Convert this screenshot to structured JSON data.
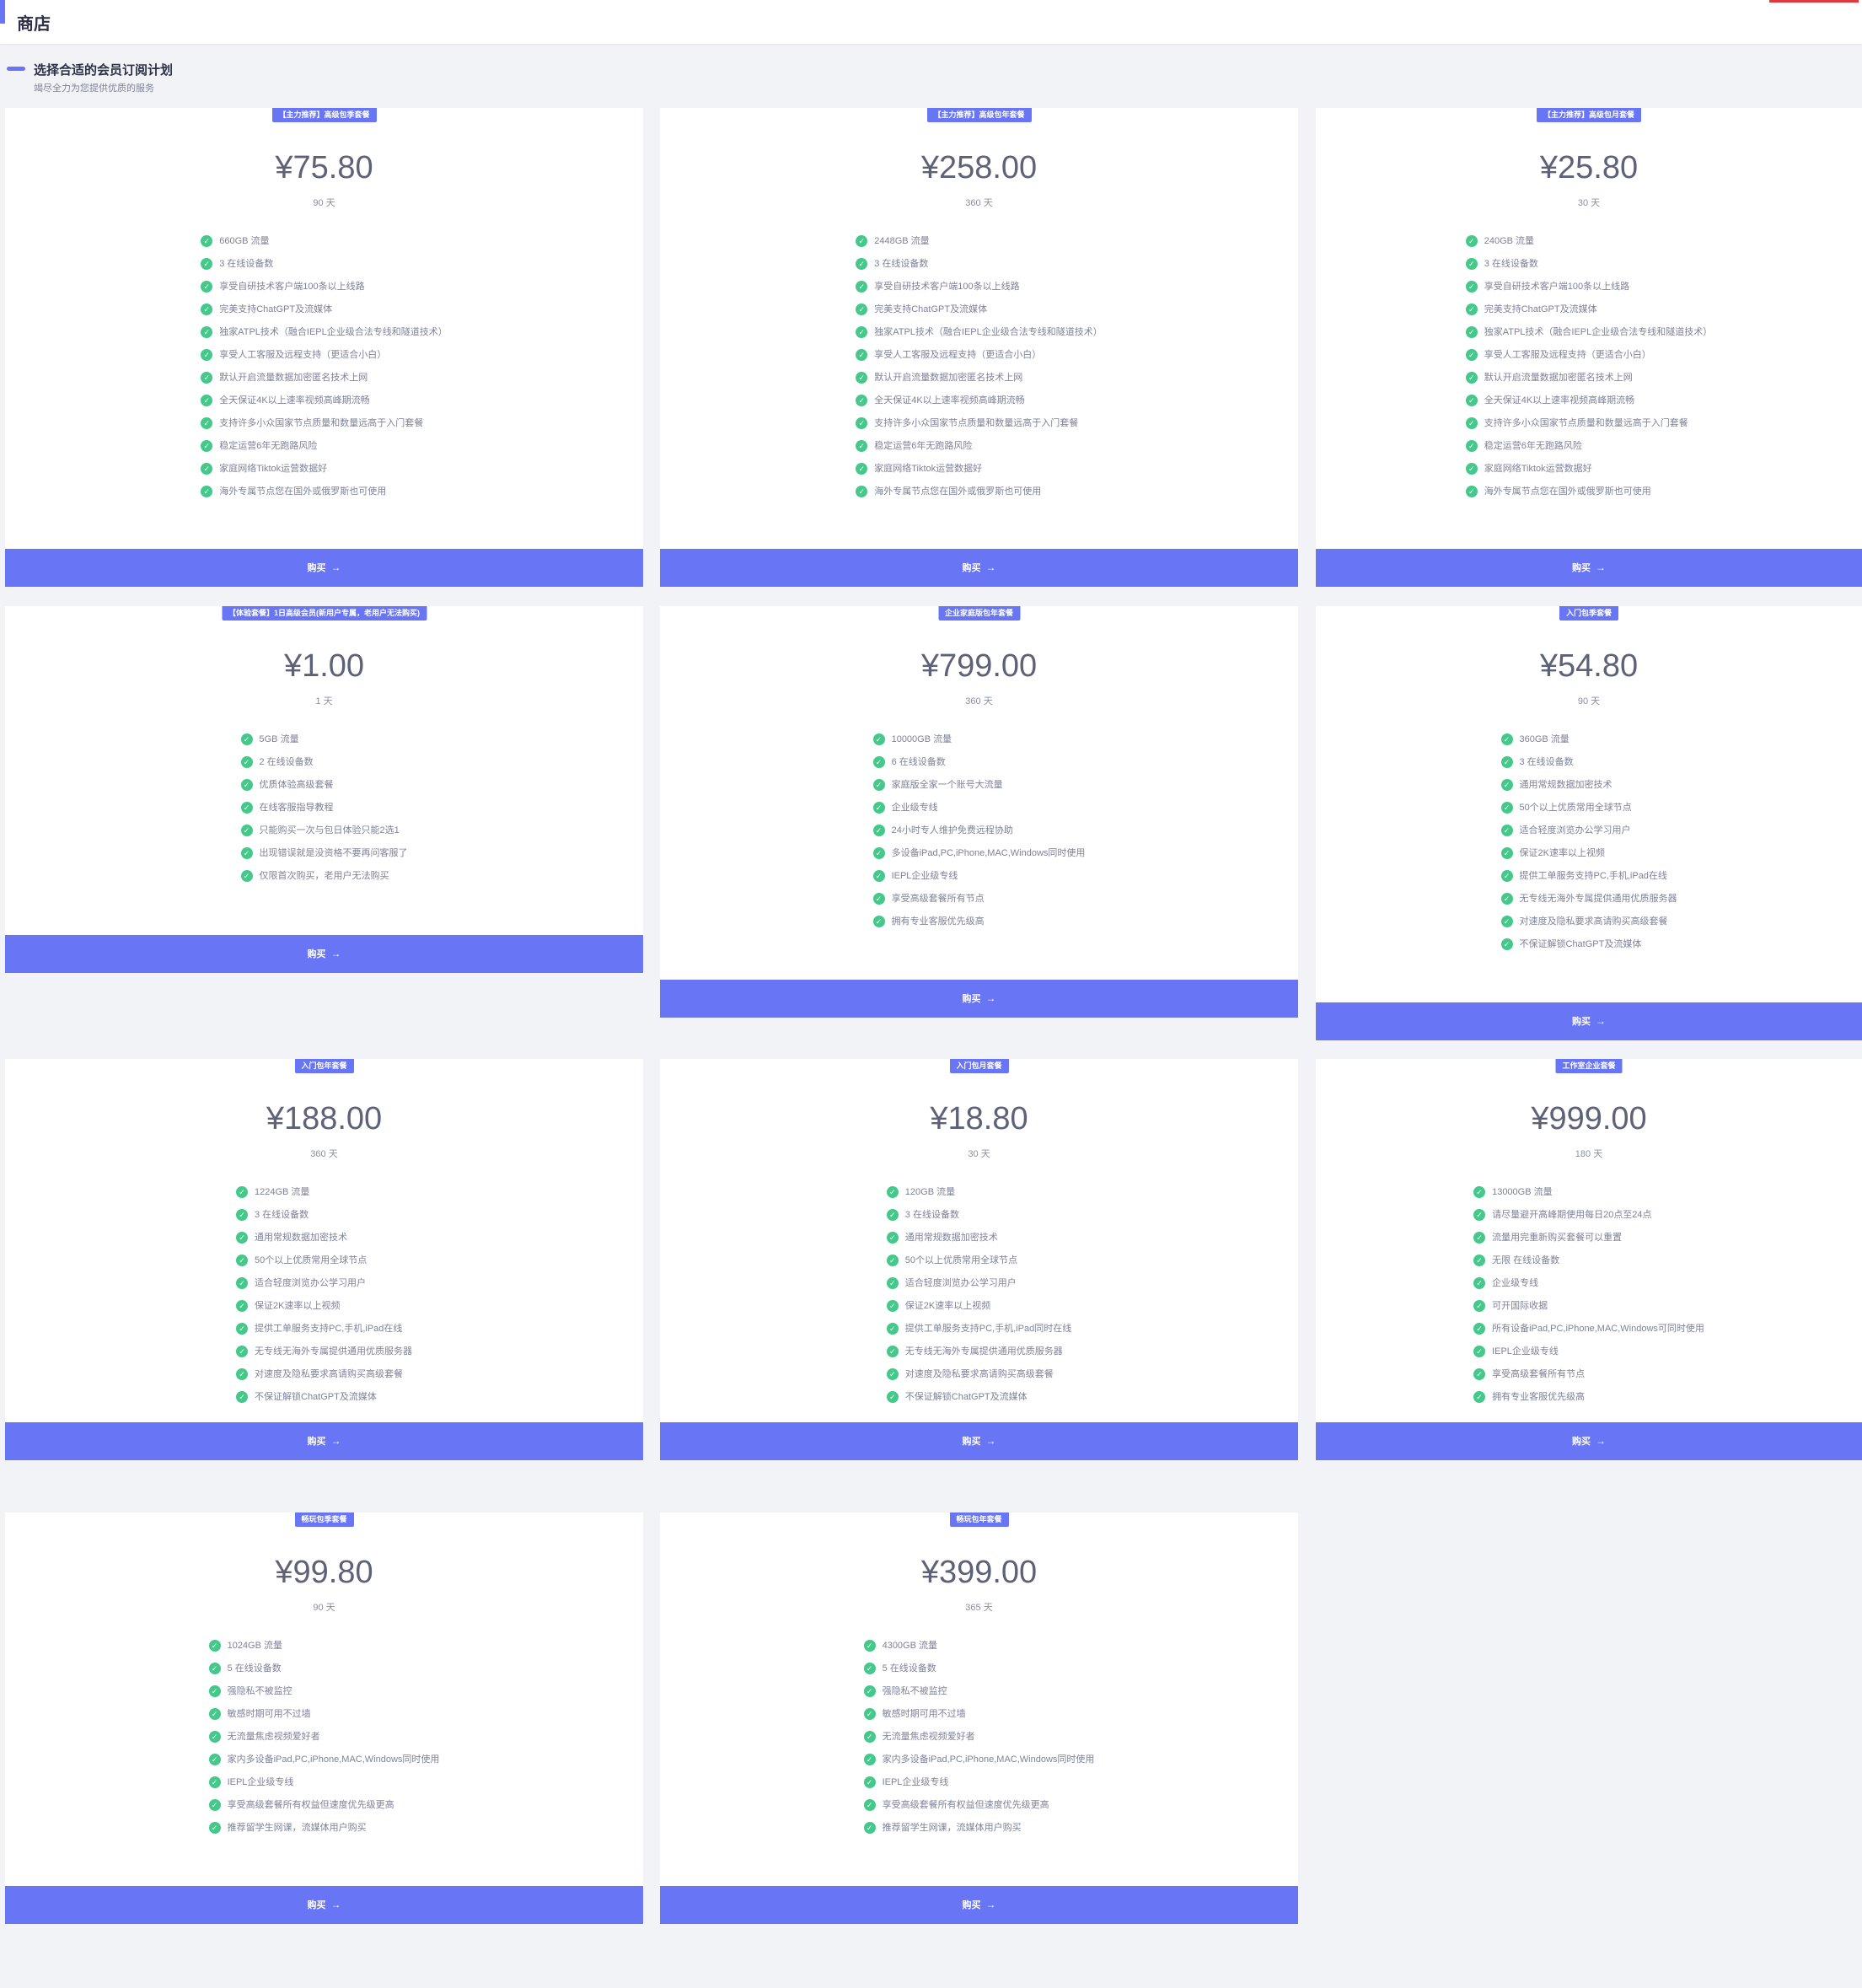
{
  "header": {
    "title": "商店"
  },
  "section": {
    "title": "选择合适的会员订阅计划",
    "subtitle": "竭尽全力为您提供优质的服务"
  },
  "buy_label": "购买",
  "plans": [
    {
      "badge": "【主力推荐】高级包季套餐",
      "price": "¥75.80",
      "period": "90 天",
      "features": [
        "660GB 流量",
        "3 在线设备数",
        "享受自研技术客户端100条以上线路",
        "完美支持ChatGPT及流媒体",
        "独家ATPL技术（融合IEPL企业级合法专线和隧道技术）",
        "享受人工客服及远程支持（更适合小白）",
        "默认开启流量数据加密匿名技术上网",
        "全天保证4K以上速率视频高峰期流畅",
        "支持许多小众国家节点质量和数量远高于入门套餐",
        "稳定运营6年无跑路风险",
        "家庭网络Tiktok运营数据好",
        "海外专属节点您在国外或俄罗斯也可使用"
      ]
    },
    {
      "badge": "【主力推荐】高级包年套餐",
      "price": "¥258.00",
      "period": "360 天",
      "features": [
        "2448GB 流量",
        "3 在线设备数",
        "享受自研技术客户端100条以上线路",
        "完美支持ChatGPT及流媒体",
        "独家ATPL技术（融合IEPL企业级合法专线和隧道技术）",
        "享受人工客服及远程支持（更适合小白）",
        "默认开启流量数据加密匿名技术上网",
        "全天保证4K以上速率视频高峰期流畅",
        "支持许多小众国家节点质量和数量远高于入门套餐",
        "稳定运营6年无跑路风险",
        "家庭网络Tiktok运营数据好",
        "海外专属节点您在国外或俄罗斯也可使用"
      ]
    },
    {
      "badge": "【主力推荐】高级包月套餐",
      "price": "¥25.80",
      "period": "30 天",
      "features": [
        "240GB 流量",
        "3 在线设备数",
        "享受自研技术客户端100条以上线路",
        "完美支持ChatGPT及流媒体",
        "独家ATPL技术（融合IEPL企业级合法专线和隧道技术）",
        "享受人工客服及远程支持（更适合小白）",
        "默认开启流量数据加密匿名技术上网",
        "全天保证4K以上速率视频高峰期流畅",
        "支持许多小众国家节点质量和数量远高于入门套餐",
        "稳定运营6年无跑路风险",
        "家庭网络Tiktok运营数据好",
        "海外专属节点您在国外或俄罗斯也可使用"
      ]
    },
    {
      "badge": "【体验套餐】1日高级会员(新用户专属，老用户无法购买)",
      "price": "¥1.00",
      "period": "1 天",
      "features": [
        "5GB 流量",
        "2 在线设备数",
        "优质体验高级套餐",
        "在线客服指导教程",
        "只能购买一次与包日体验只能2选1",
        "出现错误就是没资格不要再问客服了",
        "仅限首次购买，老用户无法购买"
      ]
    },
    {
      "badge": "企业家庭版包年套餐",
      "price": "¥799.00",
      "period": "360 天",
      "features": [
        "10000GB 流量",
        "6 在线设备数",
        "家庭版全家一个账号大流量",
        "企业级专线",
        "24小时专人维护免费远程协助",
        "多设备iPad,PC,iPhone,MAC,Windows同时使用",
        "IEPL企业级专线",
        "享受高级套餐所有节点",
        "拥有专业客服优先级高"
      ]
    },
    {
      "badge": "入门包季套餐",
      "price": "¥54.80",
      "period": "90 天",
      "features": [
        "360GB 流量",
        "3 在线设备数",
        "通用常规数据加密技术",
        "50个以上优质常用全球节点",
        "适合轻度浏览办公学习用户",
        "保证2K速率以上视频",
        "提供工单服务支持PC,手机,iPad在线",
        "无专线无海外专属提供通用优质服务器",
        "对速度及隐私要求高请购买高级套餐",
        "不保证解锁ChatGPT及流媒体"
      ]
    },
    {
      "badge": "入门包年套餐",
      "price": "¥188.00",
      "period": "360 天",
      "features": [
        "1224GB 流量",
        "3 在线设备数",
        "通用常规数据加密技术",
        "50个以上优质常用全球节点",
        "适合轻度浏览办公学习用户",
        "保证2K速率以上视频",
        "提供工单服务支持PC,手机,iPad在线",
        "无专线无海外专属提供通用优质服务器",
        "对速度及隐私要求高请购买高级套餐",
        "不保证解锁ChatGPT及流媒体"
      ]
    },
    {
      "badge": "入门包月套餐",
      "price": "¥18.80",
      "period": "30 天",
      "features": [
        "120GB 流量",
        "3 在线设备数",
        "通用常规数据加密技术",
        "50个以上优质常用全球节点",
        "适合轻度浏览办公学习用户",
        "保证2K速率以上视频",
        "提供工单服务支持PC,手机,iPad同时在线",
        "无专线无海外专属提供通用优质服务器",
        "对速度及隐私要求高请购买高级套餐",
        "不保证解锁ChatGPT及流媒体"
      ]
    },
    {
      "badge": "工作室企业套餐",
      "price": "¥999.00",
      "period": "180 天",
      "features": [
        "13000GB 流量",
        "请尽量避开高峰期使用每日20点至24点",
        "流量用完重新购买套餐可以重置",
        "无限 在线设备数",
        "企业级专线",
        "可开国际收据",
        "所有设备iPad,PC,iPhone,MAC,Windows可同时使用",
        "IEPL企业级专线",
        "享受高级套餐所有节点",
        "拥有专业客服优先级高"
      ]
    },
    {
      "badge": "畅玩包季套餐",
      "price": "¥99.80",
      "period": "90 天",
      "features": [
        "1024GB 流量",
        "5 在线设备数",
        "强隐私不被监控",
        "敏感时期可用不过墙",
        "无流量焦虑视频爱好者",
        "家内多设备iPad,PC,iPhone,MAC,Windows同时使用",
        "IEPL企业级专线",
        "享受高级套餐所有权益但速度优先级更高",
        "推荐留学生网课，流媒体用户购买"
      ]
    },
    {
      "badge": "畅玩包年套餐",
      "price": "¥399.00",
      "period": "365 天",
      "features": [
        "4300GB 流量",
        "5 在线设备数",
        "强隐私不被监控",
        "敏感时期可用不过墙",
        "无流量焦虑视频爱好者",
        "家内多设备iPad,PC,iPhone,MAC,Windows同时使用",
        "IEPL企业级专线",
        "享受高级套餐所有权益但速度优先级更高",
        "推荐留学生网课，流媒体用户购买"
      ]
    }
  ]
}
